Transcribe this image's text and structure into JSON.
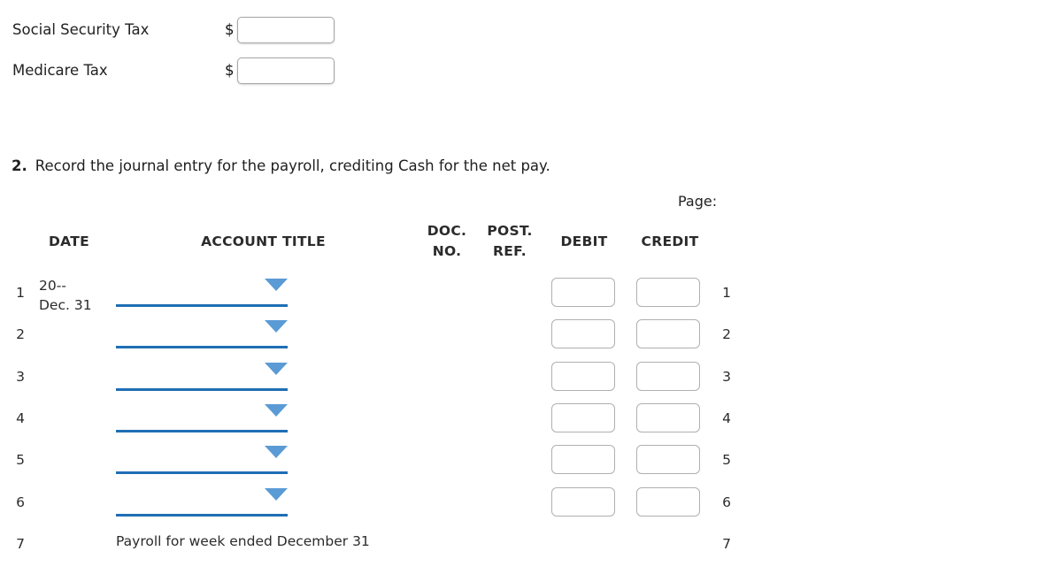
{
  "tax_section": {
    "rows": [
      {
        "label": "Social Security Tax",
        "currency": "$",
        "value": "",
        "placeholder": ""
      },
      {
        "label": "Medicare Tax",
        "currency": "$",
        "value": "",
        "placeholder": ""
      }
    ]
  },
  "question": {
    "number": "2.",
    "text": "Record the journal entry for the payroll, crediting Cash for the net pay."
  },
  "journal": {
    "page_label": "Page:",
    "headers": {
      "date": "DATE",
      "account_title": "ACCOUNT TITLE",
      "doc_no_line1": "DOC.",
      "doc_no_line2": "NO.",
      "post_ref_line1": "POST.",
      "post_ref_line2": "REF.",
      "debit": "DEBIT",
      "credit": "CREDIT"
    },
    "rows": [
      {
        "num_left": "1",
        "num_right": "1",
        "date_line1": "20--",
        "date_line2": "Dec. 31",
        "account_select": "",
        "memo": "",
        "debit": "",
        "credit": "",
        "has_select": true,
        "has_amounts": true
      },
      {
        "num_left": "2",
        "num_right": "2",
        "date_line1": "",
        "date_line2": "",
        "account_select": "",
        "memo": "",
        "debit": "",
        "credit": "",
        "has_select": true,
        "has_amounts": true
      },
      {
        "num_left": "3",
        "num_right": "3",
        "date_line1": "",
        "date_line2": "",
        "account_select": "",
        "memo": "",
        "debit": "",
        "credit": "",
        "has_select": true,
        "has_amounts": true
      },
      {
        "num_left": "4",
        "num_right": "4",
        "date_line1": "",
        "date_line2": "",
        "account_select": "",
        "memo": "",
        "debit": "",
        "credit": "",
        "has_select": true,
        "has_amounts": true
      },
      {
        "num_left": "5",
        "num_right": "5",
        "date_line1": "",
        "date_line2": "",
        "account_select": "",
        "memo": "",
        "debit": "",
        "credit": "",
        "has_select": true,
        "has_amounts": true
      },
      {
        "num_left": "6",
        "num_right": "6",
        "date_line1": "",
        "date_line2": "",
        "account_select": "",
        "memo": "",
        "debit": "",
        "credit": "",
        "has_select": true,
        "has_amounts": true
      },
      {
        "num_left": "7",
        "num_right": "7",
        "date_line1": "",
        "date_line2": "",
        "account_select": "",
        "memo": "Payroll for week ended December 31",
        "debit": "",
        "credit": "",
        "has_select": false,
        "has_amounts": false
      }
    ]
  },
  "colors": {
    "select_underline": "#1f6eb4",
    "select_arrow": "#5b9bd5",
    "box_border": "#b0b0b0",
    "input_border": "#a6a6a6",
    "text": "#2b2b2b"
  }
}
